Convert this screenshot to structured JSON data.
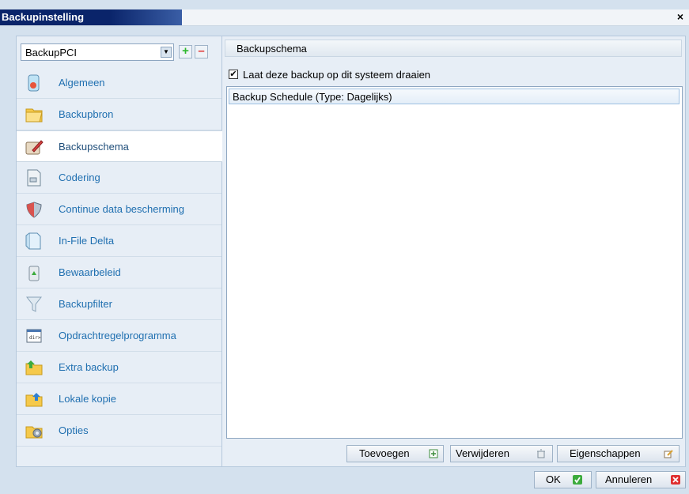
{
  "window": {
    "title": "Backupinstelling",
    "close_glyph": "×"
  },
  "left": {
    "combo_value": "BackupPCI",
    "add_glyph": "+",
    "remove_glyph": "–",
    "items": [
      {
        "label": "Algemeen",
        "icon": "general-icon"
      },
      {
        "label": "Backupbron",
        "icon": "folder-icon"
      },
      {
        "label": "Backupschema",
        "icon": "schedule-icon",
        "active": true
      },
      {
        "label": "Codering",
        "icon": "encryption-icon"
      },
      {
        "label": "Continue data bescherming",
        "icon": "shield-icon"
      },
      {
        "label": "In-File Delta",
        "icon": "delta-icon"
      },
      {
        "label": "Bewaarbeleid",
        "icon": "recycle-bin-icon"
      },
      {
        "label": "Backupfilter",
        "icon": "filter-icon"
      },
      {
        "label": "Opdrachtregelprogramma",
        "icon": "command-line-icon"
      },
      {
        "label": "Extra backup",
        "icon": "extra-backup-icon"
      },
      {
        "label": "Lokale kopie",
        "icon": "local-copy-icon"
      },
      {
        "label": "Opties",
        "icon": "options-icon"
      }
    ]
  },
  "right": {
    "section_title": "Backupschema",
    "checkbox_label": "Laat deze backup op dit systeem draaien",
    "checkbox_checked": true,
    "check_glyph": "✔",
    "schedules": [
      "Backup Schedule (Type: Dagelijks)"
    ],
    "buttons": {
      "add": "Toevoegen",
      "remove": "Verwijderen",
      "properties": "Eigenschappen"
    }
  },
  "footer": {
    "ok": "OK",
    "cancel": "Annuleren"
  }
}
